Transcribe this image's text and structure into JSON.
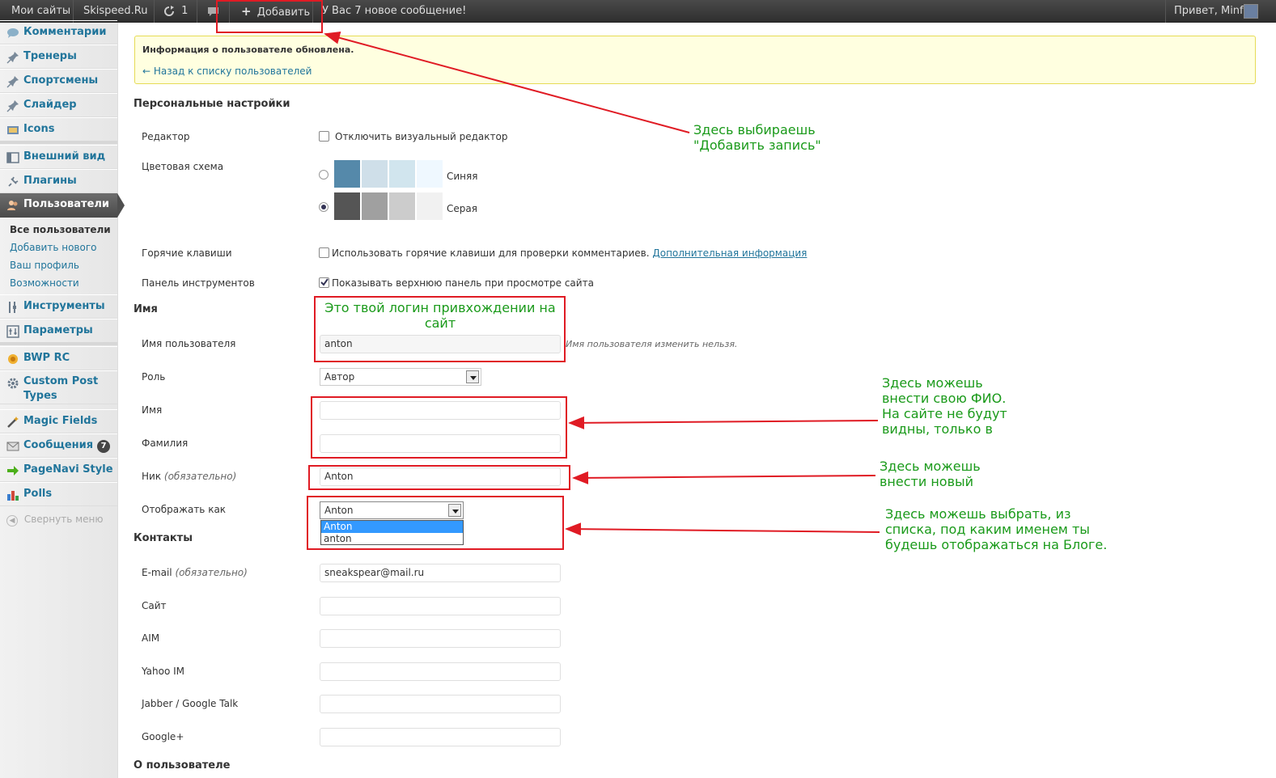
{
  "adminbar": {
    "my_sites": "Мои сайты",
    "site_name": "Skispeed.Ru",
    "updates_count": "1",
    "add_label": "Добавить",
    "new_message": "У Вас 7 новое сообщение!",
    "greeting": "Привет, Minfo"
  },
  "sidebar": {
    "items": [
      {
        "label": "Комментарии",
        "icon": "comment-icon"
      },
      {
        "label": "Тренеры",
        "icon": "pin-icon"
      },
      {
        "label": "Спортсмены",
        "icon": "pin-icon"
      },
      {
        "label": "Слайдер",
        "icon": "pin-icon"
      },
      {
        "label": "Icons",
        "icon": "image-icon"
      },
      {
        "label": "Внешний вид",
        "icon": "appearance-icon"
      },
      {
        "label": "Плагины",
        "icon": "plugin-icon"
      },
      {
        "label": "Пользователи",
        "icon": "users-icon"
      },
      {
        "label": "Инструменты",
        "icon": "tools-icon"
      },
      {
        "label": "Параметры",
        "icon": "settings-icon"
      },
      {
        "label": "BWP RC",
        "icon": "bwp-icon"
      },
      {
        "label": "Custom Post Types",
        "icon": "gear-icon"
      },
      {
        "label": "Magic Fields",
        "icon": "magic-icon"
      },
      {
        "label": "Сообщения",
        "icon": "mail-icon",
        "badge": "7"
      },
      {
        "label": "PageNavi Style",
        "icon": "arrow-right-icon"
      },
      {
        "label": "Polls",
        "icon": "chart-icon"
      }
    ],
    "submenu": [
      "Все пользователи",
      "Добавить нового",
      "Ваш профиль",
      "Возможности"
    ],
    "collapse": "Свернуть меню"
  },
  "notice": {
    "message": "Информация о пользователе обновлена.",
    "back_link": "← Назад к списку пользователей"
  },
  "personal": {
    "title": "Персональные настройки",
    "editor_label": "Редактор",
    "editor_option": "Отключить визуальный редактор",
    "color_label": "Цветовая схема",
    "scheme_blue": "Синяя",
    "scheme_gray": "Серая",
    "hotkeys_label": "Горячие клавиши",
    "hotkeys_option": "Использовать горячие клавиши для проверки комментариев.",
    "hotkeys_link": "Дополнительная информация",
    "toolbar_label": "Панель инструментов",
    "toolbar_option": "Показывать верхнюю панель при просмотре сайта"
  },
  "name_section": {
    "title": "Имя",
    "username_label": "Имя пользователя",
    "username_value": "anton",
    "username_note": "Имя пользователя изменить нельзя.",
    "role_label": "Роль",
    "role_value": "Автор",
    "first_label": "Имя",
    "first_value": "",
    "last_label": "Фамилия",
    "last_value": "",
    "nick_label": "Ник",
    "nick_required": "(обязательно)",
    "nick_value": "Anton",
    "display_label": "Отображать как",
    "display_value": "Anton",
    "display_options": [
      "Anton",
      "anton"
    ]
  },
  "contacts": {
    "title": "Контакты",
    "email_label": "E-mail",
    "email_required": "(обязательно)",
    "email_value": "sneakspear@mail.ru",
    "site_label": "Сайт",
    "aim_label": "AIM",
    "yahoo_label": "Yahoo IM",
    "jabber_label": "Jabber / Google Talk",
    "gplus_label": "Google+"
  },
  "about": {
    "title": "О пользователе"
  },
  "annotations": {
    "add_note_1": "Здесь выбираешь",
    "add_note_2": "\"Добавить запись\"",
    "login_note_1": "Это твой логин привхождении на",
    "login_note_2": "сайт",
    "fio_note_1": "Здесь можешь",
    "fio_note_2": "внести свою ФИО.",
    "fio_note_3": "На сайте не будут",
    "fio_note_4": "видны, только в",
    "nick_note_1": "Здесь можешь",
    "nick_note_2": "внести новый",
    "display_note_1": "Здесь можешь выбрать, из",
    "display_note_2": "списка, под каким именем ты",
    "display_note_3": "будешь отображаться на Блоге."
  },
  "colors": {
    "link": "#21759b",
    "adminbar": "#333333",
    "annotation_red": "#e01b24",
    "annotation_green": "#1a9a1a",
    "blue_scheme": [
      "#5589aa",
      "#cfdfe9",
      "#d1e5ee",
      "#eff8ff"
    ],
    "gray_scheme": [
      "#555555",
      "#a0a0a0",
      "#cccccc",
      "#f1f1f1"
    ]
  }
}
